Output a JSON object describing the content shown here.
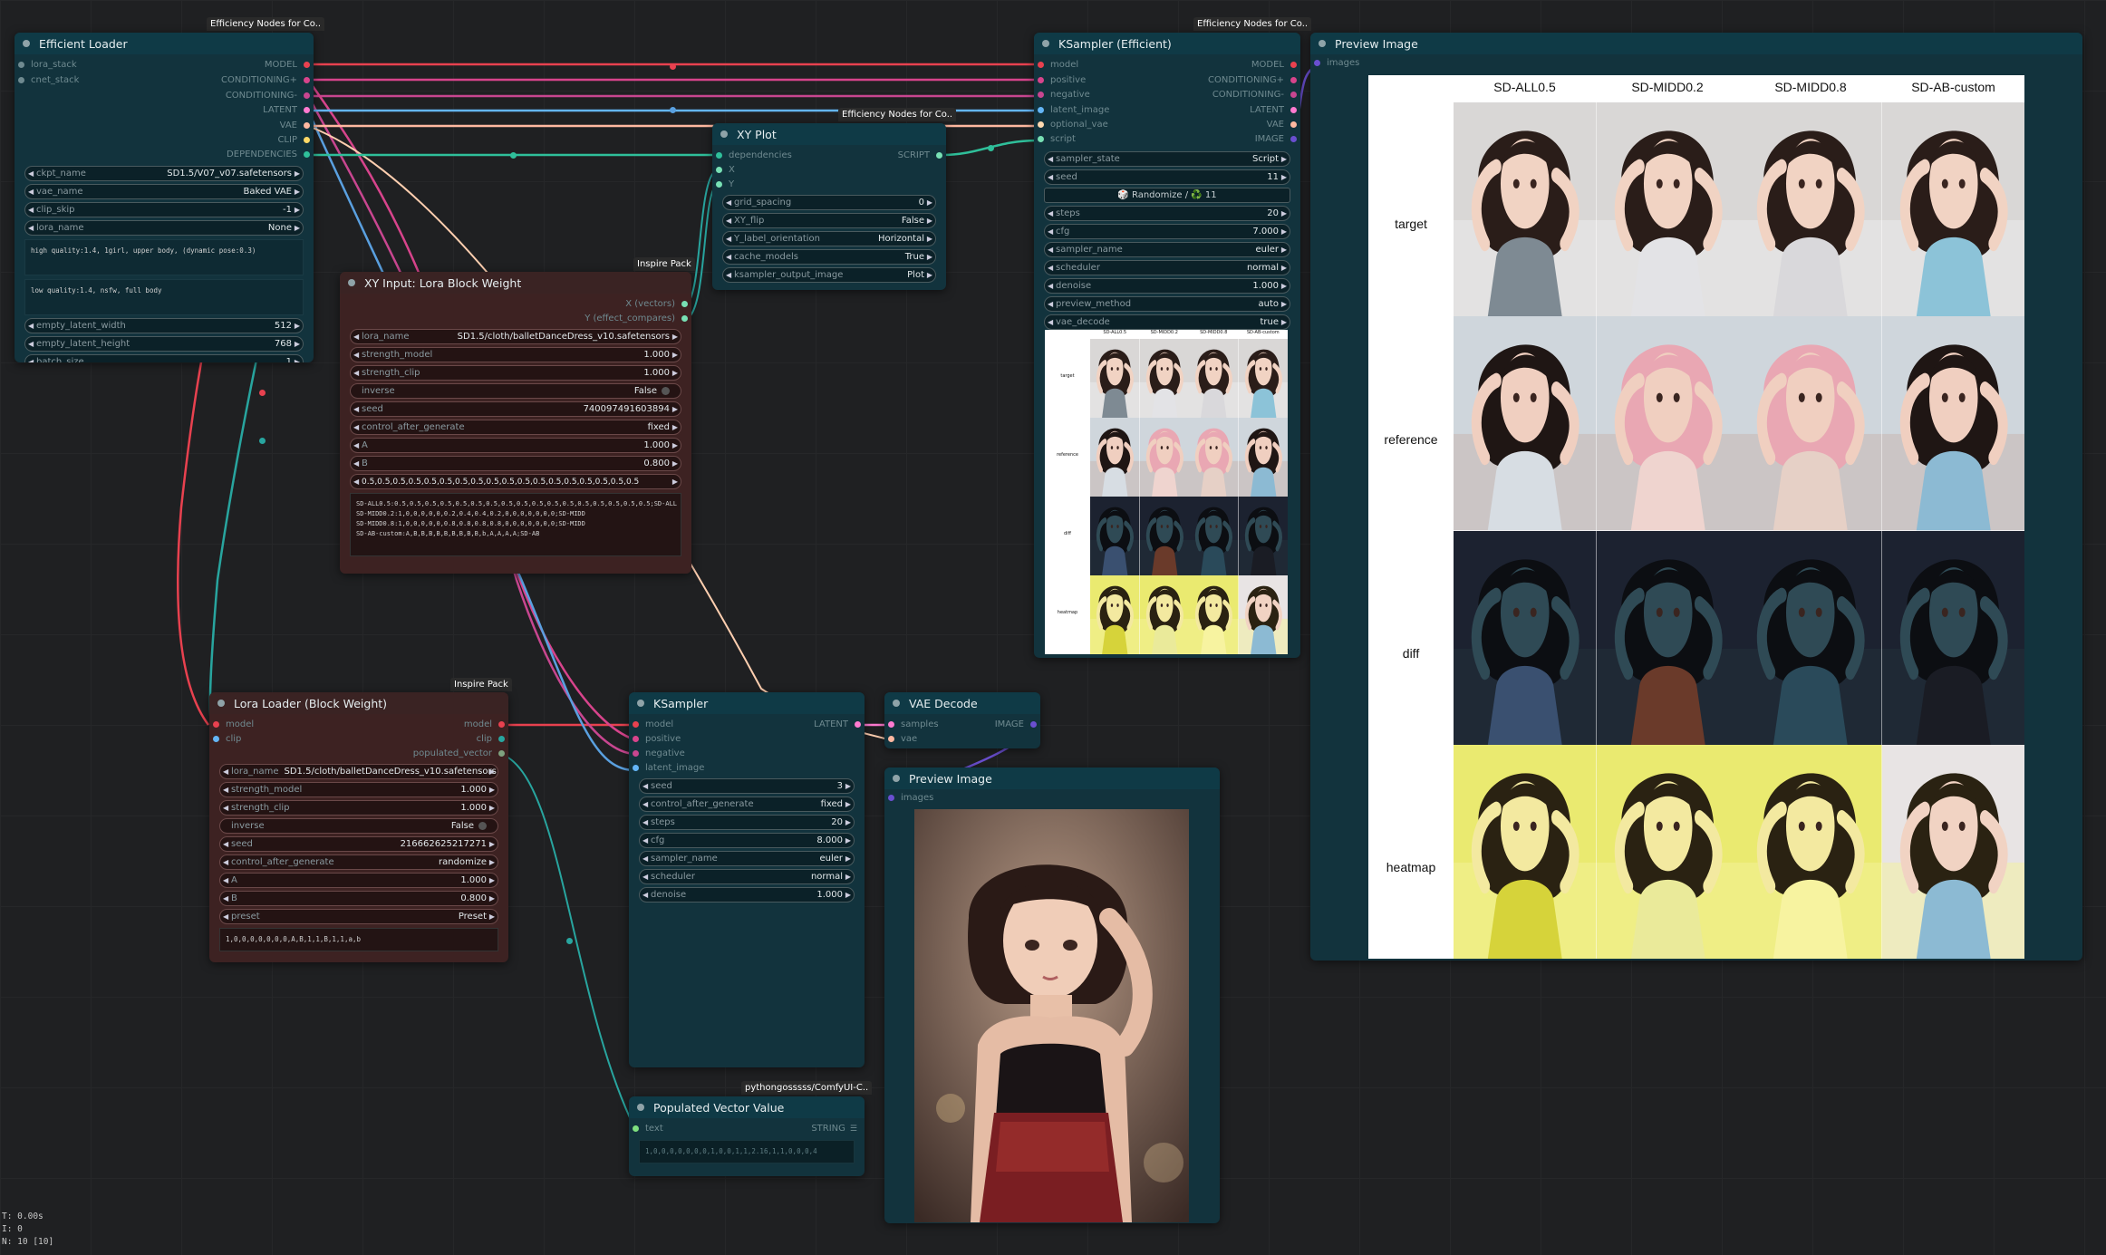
{
  "colors": {
    "model": "#e8414f",
    "clip": "#ffd966",
    "conditioning_pos": "#d7448c",
    "conditioning_neg": "#c84690",
    "latent": "#ff7ad0",
    "vae": "#ffb8a0",
    "image": "#64b5f6",
    "dependencies": "#2fbf9a",
    "script": "#78e0b4",
    "string": "#7fa27f",
    "teal": "#28a59f"
  },
  "efficient_loader": {
    "badge": "Efficiency Nodes for Co..",
    "title": "Efficient Loader",
    "inputs": [
      "lora_stack",
      "cnet_stack"
    ],
    "outputs": [
      "MODEL",
      "CONDITIONING+",
      "CONDITIONING-",
      "LATENT",
      "VAE",
      "CLIP",
      "DEPENDENCIES"
    ],
    "widgets": [
      {
        "name": "ckpt_name",
        "value": "SD1.5/V07_v07.safetensors"
      },
      {
        "name": "vae_name",
        "value": "Baked VAE"
      },
      {
        "name": "clip_skip",
        "value": "-1"
      },
      {
        "name": "lora_name",
        "value": "None"
      }
    ],
    "positive": "high quality:1.4, 1girl, upper body, (dynamic pose:0.3)",
    "negative": "low quality:1.4, nsfw, full body",
    "widgets2": [
      {
        "name": "empty_latent_width",
        "value": "512"
      },
      {
        "name": "empty_latent_height",
        "value": "768"
      },
      {
        "name": "batch_size",
        "value": "1"
      }
    ]
  },
  "xy_plot": {
    "badge": "Efficiency Nodes for Co..",
    "title": "XY Plot",
    "inputs": [
      "dependencies",
      "X",
      "Y"
    ],
    "output": "SCRIPT",
    "widgets": [
      {
        "name": "grid_spacing",
        "value": "0"
      },
      {
        "name": "XY_flip",
        "value": "False"
      },
      {
        "name": "Y_label_orientation",
        "value": "Horizontal"
      },
      {
        "name": "cache_models",
        "value": "True"
      },
      {
        "name": "ksampler_output_image",
        "value": "Plot"
      }
    ]
  },
  "xy_input": {
    "badge": "Inspire Pack",
    "title": "XY Input: Lora Block Weight",
    "outputs": [
      "X (vectors)",
      "Y (effect_compares)"
    ],
    "widgets": [
      {
        "name": "lora_name",
        "value": "SD1.5/cloth/balletDanceDress_v10.safetensors"
      },
      {
        "name": "strength_model",
        "value": "1.000"
      },
      {
        "name": "strength_clip",
        "value": "1.000"
      },
      {
        "name": "inverse",
        "value": "False"
      },
      {
        "name": "seed",
        "value": "740097491603894"
      },
      {
        "name": "control_after_generate",
        "value": "fixed"
      },
      {
        "name": "A",
        "value": "1.000"
      },
      {
        "name": "B",
        "value": "0.800"
      }
    ],
    "preset_line": "0.5,0.5,0.5,0.5,0.5,0.5,0.5,0.5,0.5,0.5,0.5,0.5,0.5,0.5,0.5,0.5,0.5,0.5",
    "text": "SD-ALL0.5:0.5,0.5,0.5,0.5,0.5,0.5,0.5,0.5,0.5,0.5,0.5,0.5,0.5,0.5,0.5,0.5,0.5;SD-ALL\nSD-MIDD0.2:1,0,0,0,0,0,0.2,0.4,0.4,0.2,0,0,0,0,0,0,0;SD-MIDD\nSD-MIDD0.8:1,0,0,0,0,0,0.8,0.8,0.8,0.8,0,0,0,0,0,0,0;SD-MIDD\nSD-AB-custom:A,B,B,B,B,B,B,B,B,B,b,A,A,A,A;SD-AB"
  },
  "ksampler_eff": {
    "badge": "Efficiency Nodes for Co..",
    "title": "KSampler (Efficient)",
    "inputs": [
      "model",
      "positive",
      "negative",
      "latent_image",
      "optional_vae",
      "script"
    ],
    "outputs": [
      "MODEL",
      "CONDITIONING+",
      "CONDITIONING-",
      "LATENT",
      "VAE",
      "IMAGE"
    ],
    "widgets_a": [
      {
        "name": "sampler_state",
        "value": "Script"
      },
      {
        "name": "seed",
        "value": "11"
      }
    ],
    "randomize": "🎲 Randomize / ♻️ 11",
    "widgets_b": [
      {
        "name": "steps",
        "value": "20"
      },
      {
        "name": "cfg",
        "value": "7.000"
      },
      {
        "name": "sampler_name",
        "value": "euler"
      },
      {
        "name": "scheduler",
        "value": "normal"
      },
      {
        "name": "denoise",
        "value": "1.000"
      },
      {
        "name": "preview_method",
        "value": "auto"
      },
      {
        "name": "vae_decode",
        "value": "true"
      }
    ],
    "thumb_cols": [
      "SD-ALL0.5",
      "SD-MIDD0.2",
      "SD-MIDD0.8",
      "SD-AB-custom"
    ],
    "thumb_rows": [
      "target",
      "reference",
      "diff",
      "heatmap"
    ]
  },
  "preview_big": {
    "title": "Preview Image",
    "input": "images",
    "columns": [
      "SD-ALL0.5",
      "SD-MIDD0.2",
      "SD-MIDD0.8",
      "SD-AB-custom"
    ],
    "rows": [
      "target",
      "reference",
      "diff",
      "heatmap"
    ]
  },
  "lora_loader": {
    "badge": "Inspire Pack",
    "title": "Lora Loader (Block Weight)",
    "inputs": [
      "model",
      "clip"
    ],
    "outputs": [
      "model",
      "clip",
      "populated_vector"
    ],
    "widgets": [
      {
        "name": "lora_name",
        "value": "SD1.5/cloth/balletDanceDress_v10.safetensors"
      },
      {
        "name": "strength_model",
        "value": "1.000"
      },
      {
        "name": "strength_clip",
        "value": "1.000"
      },
      {
        "name": "inverse",
        "value": "False"
      },
      {
        "name": "seed",
        "value": "216662625217271"
      },
      {
        "name": "control_after_generate",
        "value": "randomize"
      },
      {
        "name": "A",
        "value": "1.000"
      },
      {
        "name": "B",
        "value": "0.800"
      },
      {
        "name": "preset",
        "value": "Preset"
      }
    ],
    "text": "1,0,0,0,0,0,0,0,A,B,1,1,B,1,1,a,b"
  },
  "ksampler": {
    "title": "KSampler",
    "inputs": [
      "model",
      "positive",
      "negative",
      "latent_image"
    ],
    "output": "LATENT",
    "widgets": [
      {
        "name": "seed",
        "value": "3"
      },
      {
        "name": "control_after_generate",
        "value": "fixed"
      },
      {
        "name": "steps",
        "value": "20"
      },
      {
        "name": "cfg",
        "value": "8.000"
      },
      {
        "name": "sampler_name",
        "value": "euler"
      },
      {
        "name": "scheduler",
        "value": "normal"
      },
      {
        "name": "denoise",
        "value": "1.000"
      }
    ]
  },
  "vae_decode": {
    "title": "VAE Decode",
    "inputs": [
      "samples",
      "vae"
    ],
    "output": "IMAGE"
  },
  "preview_small": {
    "title": "Preview Image",
    "input": "images"
  },
  "pop_vector": {
    "badge": "pythongosssss/ComfyUI-C..",
    "title": "Populated Vector Value",
    "input": "text",
    "output": "STRING",
    "text": "1,0,0,0,0,0,0,0,1,0,0,1,1,2.16,1,1,0,0,0,4"
  },
  "stats": [
    "T: 0.00s",
    "I: 0",
    "N: 10 [10]"
  ]
}
